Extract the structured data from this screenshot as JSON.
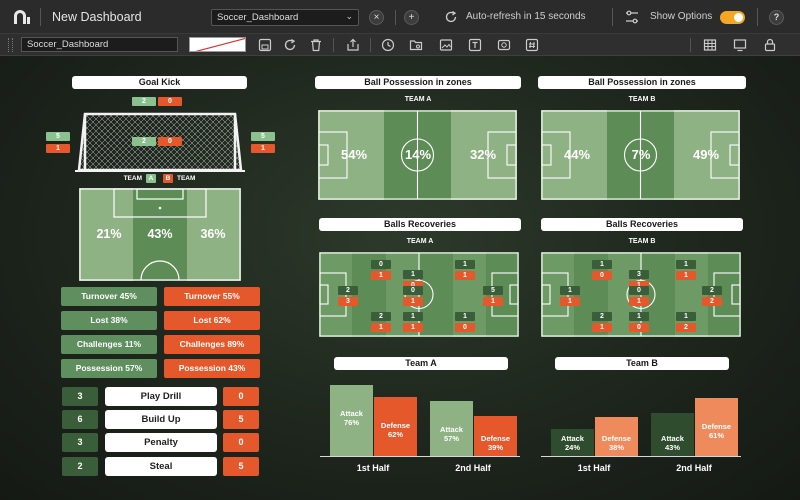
{
  "titlebar": {
    "title": "New Dashboard",
    "dashboard_select": "Soccer_Dashboard",
    "refresh_text": "Auto-refresh in 15 seconds",
    "show_options": "Show Options",
    "show_options_on": true
  },
  "toolbar": {
    "name_value": "Soccer_Dashboard"
  },
  "goal_kick": {
    "title": "Goal Kick",
    "top": {
      "a": "2",
      "b": "0"
    },
    "center": {
      "a": "2",
      "b": "0"
    },
    "left": {
      "a": "5",
      "b": "1"
    },
    "right": {
      "a": "5",
      "b": "1"
    },
    "team_left": "TEAM",
    "team_a": "A",
    "team_b": "B",
    "team_right": "TEAM"
  },
  "goal_field": {
    "left": "21%",
    "center": "43%",
    "right": "36%"
  },
  "stats": [
    {
      "a": "Turnover 45%",
      "b": "Turnover 55%"
    },
    {
      "a": "Lost 38%",
      "b": "Lost 62%"
    },
    {
      "a": "Challenges 11%",
      "b": "Challenges 89%"
    },
    {
      "a": "Possession 57%",
      "b": "Possession 43%"
    }
  ],
  "drills": [
    {
      "a": "3",
      "label": "Play Drill",
      "b": "0"
    },
    {
      "a": "6",
      "label": "Build Up",
      "b": "5"
    },
    {
      "a": "3",
      "label": "Penalty",
      "b": "0"
    },
    {
      "a": "2",
      "label": "Steal",
      "b": "5"
    }
  ],
  "possession": {
    "a": {
      "title": "Ball Possession in zones",
      "team": "TEAM A",
      "zones": [
        "54%",
        "14%",
        "32%"
      ]
    },
    "b": {
      "title": "Ball Possession in zones",
      "team": "TEAM B",
      "zones": [
        "44%",
        "7%",
        "49%"
      ]
    }
  },
  "recoveries": {
    "a": {
      "title": "Balls Recoveries",
      "team": "TEAM A",
      "markers": [
        {
          "g": "0",
          "o": "1"
        },
        {
          "g": "1",
          "o": "0"
        },
        {
          "g": "1",
          "o": "1"
        },
        {
          "g": "2",
          "o": "3"
        },
        {
          "g": "0",
          "o": "1"
        },
        {
          "g": "5",
          "o": "1"
        },
        {
          "g": "2",
          "o": "1"
        },
        {
          "g": "1",
          "o": "1"
        },
        {
          "g": "1",
          "o": "0"
        }
      ]
    },
    "b": {
      "title": "Balls Recoveries",
      "team": "TEAM B",
      "markers": [
        {
          "g": "1",
          "o": "0"
        },
        {
          "g": "3",
          "o": "1"
        },
        {
          "g": "1",
          "o": "1"
        },
        {
          "g": "1",
          "o": "1"
        },
        {
          "g": "0",
          "o": "1"
        },
        {
          "g": "2",
          "o": "2"
        },
        {
          "g": "2",
          "o": "1"
        },
        {
          "g": "1",
          "o": "0"
        },
        {
          "g": "1",
          "o": "2"
        }
      ]
    }
  },
  "chart_data": [
    {
      "type": "bar",
      "title": "Team A",
      "categories": [
        "1st Half",
        "2nd Half"
      ],
      "series": [
        {
          "name": "Attack",
          "values": [
            76,
            57
          ]
        },
        {
          "name": "Defense",
          "values": [
            62,
            39
          ]
        }
      ],
      "ylim": [
        0,
        100
      ]
    },
    {
      "type": "bar",
      "title": "Team B",
      "categories": [
        "1st Half",
        "2nd Half"
      ],
      "series": [
        {
          "name": "Attack",
          "values": [
            24,
            43
          ]
        },
        {
          "name": "Defense",
          "values": [
            38,
            61
          ]
        }
      ],
      "ylim": [
        0,
        100
      ]
    }
  ],
  "colors": {
    "field_light": "#8fb285",
    "field_dark": "#5e8c57",
    "orange": "#e4582b",
    "green_badge": "#8bc08f",
    "dark_green": "#3b5e3a",
    "toggle": "#f5a623"
  }
}
